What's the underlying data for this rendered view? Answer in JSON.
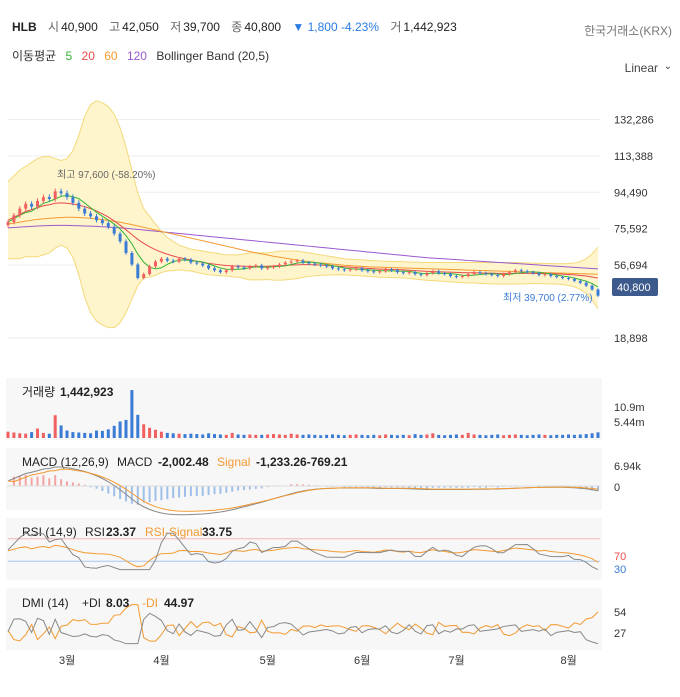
{
  "header": {
    "symbol": "HLB",
    "open_label": "시",
    "open": "40,900",
    "high_label": "고",
    "high": "42,050",
    "low_label": "저",
    "low": "39,700",
    "close_label": "종",
    "close": "40,800",
    "change": "▼ 1,800 -4.23%",
    "volume_label": "거",
    "volume": "1,442,923",
    "exchange": "한국거래소(KRX)"
  },
  "indicators_line": {
    "ma_label": "이동평균",
    "ma_periods": [
      "5",
      "20",
      "60",
      "120"
    ],
    "bollinger_label": "Bollinger Band (20,5)"
  },
  "scale": {
    "label": "Linear"
  },
  "colors": {
    "up": "#f06060",
    "down": "#3a7bd5",
    "ma5": "#32b432",
    "ma20": "#e84b4b",
    "ma60": "#f39a31",
    "ma120": "#9b59d0",
    "band_fill": "#fff5cc",
    "band_line": "#f3d97a",
    "price_tag": "#3d5a8c"
  },
  "chart_data": [
    {
      "type": "candlestick",
      "name": "price",
      "y_ticks": [
        "132,286",
        "113,388",
        "94,490",
        "75,592",
        "56,694",
        "18,898"
      ],
      "y_tick_values": [
        132286,
        113388,
        94490,
        75592,
        56694,
        18898
      ],
      "ylim": [
        10000,
        145000
      ],
      "x_ticks": [
        "3월",
        "4월",
        "5월",
        "6월",
        "7월",
        "8월"
      ],
      "max_annotation": "최고 97,600 (-58.20%)",
      "min_annotation": "최저 39,700 (2.77%)",
      "last_price_tag": "40,800",
      "closes": [
        79000,
        82500,
        86000,
        88500,
        87000,
        90000,
        92000,
        91000,
        95000,
        94000,
        92000,
        89000,
        86000,
        83500,
        82000,
        80000,
        78500,
        76500,
        73000,
        69000,
        63000,
        57000,
        50000,
        52000,
        56000,
        58500,
        60000,
        59000,
        58500,
        60000,
        59500,
        58000,
        57500,
        56500,
        55000,
        54000,
        53000,
        54000,
        56000,
        55500,
        55000,
        56000,
        56500,
        55000,
        55500,
        56000,
        57000,
        58000,
        58500,
        59000,
        58000,
        57500,
        57000,
        56500,
        56000,
        55000,
        54500,
        54000,
        54500,
        55000,
        54000,
        53500,
        53000,
        53500,
        54500,
        54000,
        53000,
        52500,
        53000,
        52000,
        51500,
        52500,
        53500,
        52500,
        52000,
        51000,
        50500,
        51000,
        52000,
        53000,
        52500,
        52000,
        51500,
        51000,
        52000,
        53000,
        54000,
        53500,
        53000,
        52500,
        51500,
        52000,
        51000,
        50500,
        50000,
        49500,
        48500,
        47500,
        46000,
        44000,
        40800
      ],
      "ma20": [
        80000,
        81500,
        83000,
        84500,
        85500,
        86500,
        87500,
        88000,
        88800,
        89000,
        88800,
        88400,
        87800,
        87000,
        86000,
        84800,
        83300,
        81600,
        79600,
        77400,
        75000,
        72500,
        70000,
        68000,
        66200,
        64700,
        63400,
        62300,
        61400,
        60600,
        59900,
        59300,
        58700,
        58100,
        57600,
        57200,
        56800,
        56500,
        56300,
        56200,
        56100,
        56000,
        56000,
        56000,
        56100,
        56200,
        56400,
        56500,
        56700,
        56800,
        56900,
        56900,
        56800,
        56700,
        56500,
        56300,
        56100,
        55800,
        55600,
        55400,
        55200,
        55000,
        54800,
        54600,
        54500,
        54400,
        54300,
        54200,
        54000,
        53800,
        53600,
        53400,
        53300,
        53200,
        53100,
        53000,
        52900,
        52800,
        52700,
        52700,
        52600,
        52500,
        52500,
        52400,
        52400,
        52400,
        52400,
        52400,
        52400,
        52400,
        52300,
        52300,
        52200,
        52100,
        52000,
        51800,
        51600,
        51300,
        51000,
        50500,
        50000
      ],
      "ma60": [
        78000,
        78500,
        79000,
        79500,
        80000,
        80400,
        80700,
        81000,
        81200,
        81400,
        81500,
        81500,
        81400,
        81200,
        81000,
        80700,
        80300,
        79900,
        79400,
        78900,
        78300,
        77700,
        77000,
        76300,
        75600,
        74900,
        74200,
        73500,
        72800,
        72100,
        71400,
        70700,
        70000,
        69300,
        68600,
        67900,
        67200,
        66500,
        65800,
        65100,
        64400,
        63700,
        63100,
        62500,
        61900,
        61300,
        60800,
        60300,
        59800,
        59300,
        58900,
        58500,
        58100,
        57800,
        57500,
        57200,
        56900,
        56600,
        56400,
        56200,
        56000,
        55800,
        55700,
        55600,
        55500,
        55400,
        55300,
        55200,
        55100,
        55000,
        54900,
        54800,
        54700,
        54600,
        54500,
        54400,
        54300,
        54200,
        54100,
        54000,
        53900,
        53800,
        53700,
        53600,
        53500,
        53400,
        53300,
        53200,
        53100,
        53000,
        52900,
        52800,
        52700,
        52600,
        52500,
        52400,
        52300,
        52200,
        52100,
        52000,
        51900
      ],
      "ma120": [
        76000,
        76200,
        76400,
        76600,
        76800,
        77000,
        77100,
        77200,
        77300,
        77300,
        77300,
        77200,
        77100,
        77000,
        76900,
        76800,
        76600,
        76400,
        76200,
        76000,
        75800,
        75500,
        75200,
        74900,
        74600,
        74300,
        74000,
        73700,
        73400,
        73100,
        72800,
        72500,
        72200,
        71900,
        71600,
        71300,
        71000,
        70700,
        70400,
        70100,
        69800,
        69500,
        69200,
        68900,
        68600,
        68300,
        68000,
        67700,
        67400,
        67100,
        66800,
        66500,
        66200,
        65900,
        65600,
        65300,
        65000,
        64700,
        64400,
        64100,
        63800,
        63500,
        63200,
        62900,
        62600,
        62300,
        62000,
        61700,
        61400,
        61100,
        60800,
        60500,
        60300,
        60100,
        59900,
        59700,
        59500,
        59300,
        59100,
        58900,
        58700,
        58500,
        58300,
        58100,
        57900,
        57700,
        57500,
        57300,
        57100,
        56900,
        56700,
        56500,
        56300,
        56100,
        55900,
        55700,
        55500,
        55300,
        55100,
        54900,
        54700
      ],
      "band_upper": [
        100000,
        103000,
        106000,
        108000,
        110000,
        112000,
        113000,
        113000,
        112000,
        111000,
        112000,
        116000,
        124000,
        134000,
        140000,
        142000,
        141000,
        139000,
        135000,
        128000,
        118000,
        106000,
        94000,
        86000,
        82000,
        78000,
        74000,
        71000,
        69000,
        67000,
        66000,
        65000,
        64500,
        64000,
        63500,
        63000,
        62500,
        62000,
        62000,
        62000,
        62500,
        63000,
        63000,
        63000,
        63000,
        63500,
        64000,
        64000,
        64000,
        64000,
        63500,
        63000,
        62500,
        62000,
        61500,
        61000,
        60500,
        60000,
        59800,
        59600,
        59400,
        59200,
        59000,
        58800,
        58700,
        58600,
        58500,
        58400,
        58300,
        58200,
        58100,
        58000,
        58000,
        58000,
        58000,
        58000,
        58000,
        58000,
        58000,
        58000,
        58000,
        58000,
        58000,
        58000,
        58000,
        58000,
        58000,
        57900,
        57800,
        57700,
        57600,
        57600,
        57500,
        57400,
        57400,
        57500,
        57800,
        58500,
        60000,
        62500,
        66000
      ],
      "band_lower": [
        60000,
        60000,
        60000,
        61000,
        61000,
        61000,
        62000,
        63000,
        65500,
        67000,
        65600,
        60800,
        51600,
        40000,
        32000,
        27600,
        25600,
        24200,
        24200,
        26800,
        32000,
        39000,
        46000,
        50000,
        50400,
        51400,
        52800,
        53600,
        53800,
        54200,
        53800,
        53600,
        52900,
        52200,
        51700,
        51400,
        51100,
        51000,
        50600,
        50400,
        49700,
        49000,
        49000,
        49000,
        49200,
        48900,
        48800,
        49000,
        49400,
        49600,
        50300,
        50800,
        51100,
        51400,
        51500,
        51600,
        51700,
        51600,
        51400,
        51200,
        51000,
        50800,
        50600,
        50400,
        50300,
        50200,
        50100,
        50000,
        49700,
        49400,
        49100,
        48800,
        48600,
        48400,
        48200,
        48000,
        47800,
        47600,
        47400,
        47400,
        47200,
        47000,
        47000,
        46800,
        46800,
        46800,
        46800,
        46900,
        47000,
        47100,
        47000,
        47000,
        46900,
        46800,
        46600,
        46100,
        45400,
        44100,
        42000,
        38500,
        34000
      ]
    },
    {
      "type": "bar",
      "name": "volume",
      "label": "거래량",
      "value_label": "1,442,923",
      "y_ticks": [
        "10.9m",
        "5.44m"
      ],
      "y_tick_values": [
        10900000,
        5440000
      ],
      "values": [
        1.6,
        1.4,
        1.2,
        1.1,
        1.5,
        2.4,
        1.3,
        1.1,
        5.8,
        3.2,
        1.9,
        1.5,
        1.4,
        1.3,
        1.2,
        1.9,
        1.8,
        2.2,
        3.1,
        4.2,
        4.6,
        12.2,
        5.9,
        3.5,
        2.6,
        2.1,
        1.6,
        1.3,
        1.2,
        1.1,
        1.0,
        1.1,
        1.0,
        0.9,
        1.2,
        1.0,
        0.9,
        0.8,
        1.3,
        0.9,
        0.8,
        0.9,
        0.8,
        0.8,
        0.9,
        1.0,
        0.9,
        0.8,
        1.1,
        0.9,
        0.8,
        0.9,
        0.8,
        0.7,
        0.8,
        0.9,
        0.8,
        0.7,
        0.8,
        0.9,
        0.8,
        0.7,
        0.8,
        0.7,
        0.9,
        0.8,
        0.7,
        0.8,
        0.7,
        1.0,
        0.8,
        0.9,
        1.2,
        0.8,
        0.7,
        0.8,
        0.9,
        0.8,
        1.3,
        0.9,
        0.8,
        0.7,
        0.8,
        0.9,
        0.7,
        0.8,
        0.9,
        0.8,
        0.7,
        0.8,
        0.9,
        0.8,
        0.7,
        0.8,
        0.8,
        0.9,
        0.8,
        0.9,
        1.0,
        1.2,
        1.44
      ],
      "unit": "m"
    },
    {
      "type": "line",
      "name": "macd",
      "label": "MACD (12,26,9)",
      "macd_label": "MACD",
      "macd_value": "-2,002.48",
      "signal_label": "Signal",
      "signal_value": "-1,233.26-769.21",
      "y_ticks": [
        "6.94k",
        "0"
      ],
      "y_tick_values": [
        6940,
        0
      ]
    },
    {
      "type": "line",
      "name": "rsi",
      "label": "RSI (14,9)",
      "rsi_label": "RSI",
      "rsi_value": "23.37",
      "signal_label": "RSI-Signal",
      "signal_value": "33.75",
      "y_ticks": [
        "70",
        "30"
      ],
      "y_tick_values": [
        70,
        30
      ]
    },
    {
      "type": "line",
      "name": "dmi",
      "label": "DMI (14)",
      "pdi_label": "+DI",
      "pdi_value": "8.03",
      "mdi_label": "-DI",
      "mdi_value": "44.97",
      "y_ticks": [
        "54",
        "27"
      ],
      "y_tick_values": [
        54,
        27
      ]
    }
  ]
}
